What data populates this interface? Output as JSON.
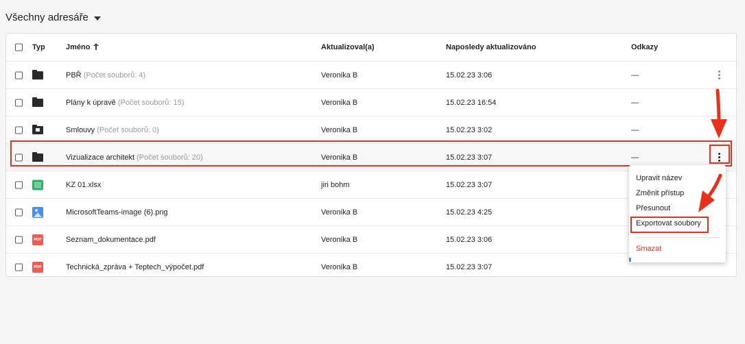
{
  "header": {
    "title": "Všechny adresáře"
  },
  "table": {
    "columns": {
      "type": "Typ",
      "name": "Jméno",
      "updated_by": "Aktualizoval(a)",
      "last_updated": "Naposledy aktualizováno",
      "links": "Odkazy"
    },
    "sort": {
      "column": "name",
      "direction": "ascending"
    },
    "rows": [
      {
        "icon": "folder-icon",
        "name": "PBŘ",
        "count": "(Počet souborů: 4)",
        "updated_by": "Veronika B",
        "date": "15.02.23 3:06",
        "links": "—"
      },
      {
        "icon": "folder-icon",
        "name": "Plány k úpravě",
        "count": "(Počet souborů: 15)",
        "updated_by": "Veronika B",
        "date": "15.02.23 16:54",
        "links": "—"
      },
      {
        "icon": "locked-folder-icon",
        "name": "Smlouvy",
        "count": "(Počet souborů: 0)",
        "updated_by": "Veronika B",
        "date": "15.02.23 3:02",
        "links": "—"
      },
      {
        "icon": "folder-icon",
        "name": "Vizualizace architekt",
        "count": "(Počet souborů: 20)",
        "updated_by": "Veronika B",
        "date": "15.02.23 3:07",
        "links": "—"
      },
      {
        "icon": "spreadsheet-icon",
        "name": "KZ 01.xlsx",
        "count": "",
        "updated_by": "jiri bohm",
        "date": "15.02.23 3:07",
        "links": ""
      },
      {
        "icon": "image-file-icon",
        "name": "MicrosoftTeams-image (6).png",
        "count": "",
        "updated_by": "Veronika B",
        "date": "15.02.23 4:25",
        "links": ""
      },
      {
        "icon": "pdf-icon",
        "name": "Seznam_dokumentace.pdf",
        "count": "",
        "updated_by": "Veronika B",
        "date": "15.02.23 3:06",
        "links": ""
      },
      {
        "icon": "pdf-icon",
        "name": "Technická_zpráva + Teptech_výpočet.pdf",
        "count": "",
        "updated_by": "Veronika B",
        "date": "15.02.23 3:07",
        "links": ""
      }
    ],
    "pdf_label": "PDF"
  },
  "context_menu": {
    "items": [
      "Upravit název",
      "Změnit přístup",
      "Přesunout",
      "Exportovat soubory"
    ],
    "danger_item": "Smazat"
  },
  "colors": {
    "annotation": "#e8311d",
    "danger": "#e8311d",
    "spreadsheet": "#2fb36b",
    "image": "#4a8cf0",
    "pdf": "#f25b50"
  }
}
